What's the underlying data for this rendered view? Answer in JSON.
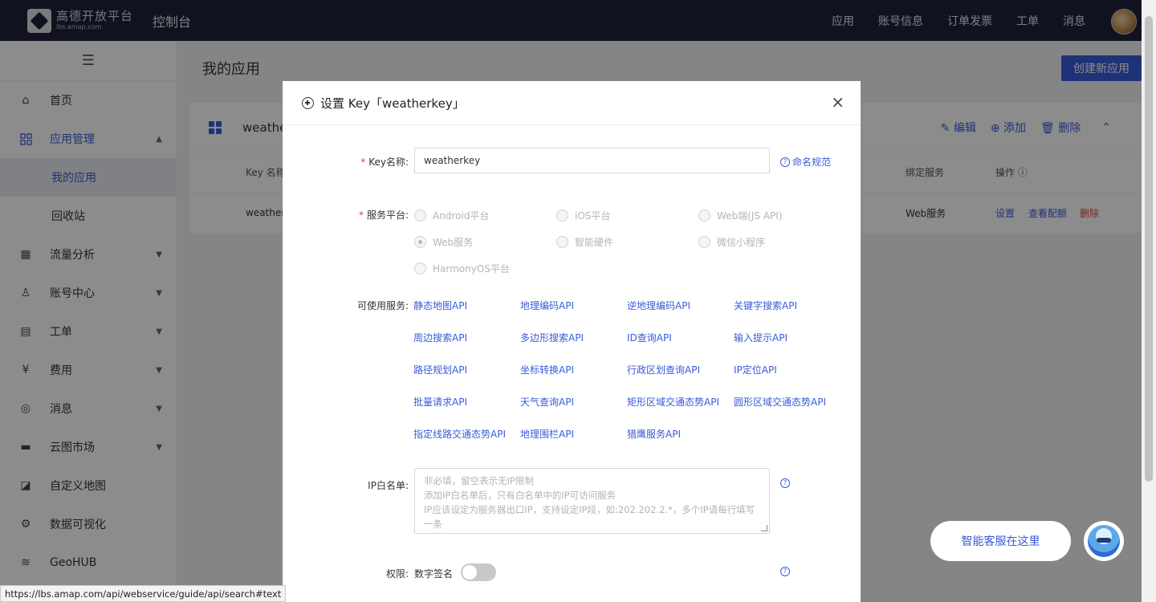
{
  "topbar": {
    "logo_line1": "高德开放平台",
    "logo_line2": "lbs.amap.com",
    "console": "控制台",
    "nav": [
      "应用",
      "账号信息",
      "订单发票",
      "工单",
      "消息"
    ]
  },
  "sidebar": {
    "toggle_icon": "☰",
    "items": [
      {
        "label": "首页",
        "icon": "home-icon"
      },
      {
        "label": "应用管理",
        "icon": "apps-icon"
      },
      {
        "label": "我的应用"
      },
      {
        "label": "回收站"
      },
      {
        "label": "流量分析",
        "icon": "chart-icon"
      },
      {
        "label": "账号中心",
        "icon": "user-icon"
      },
      {
        "label": "工单",
        "icon": "ticket-icon"
      },
      {
        "label": "费用",
        "icon": "yen-icon"
      },
      {
        "label": "消息",
        "icon": "message-icon"
      },
      {
        "label": "云图市场",
        "icon": "store-icon"
      },
      {
        "label": "自定义地图",
        "icon": "map-icon"
      },
      {
        "label": "数据可视化",
        "icon": "visual-icon"
      },
      {
        "label": "GeoHUB",
        "icon": "layers-icon"
      }
    ]
  },
  "main": {
    "title": "我的应用",
    "create_button": "创建新应用",
    "app_name": "weathe",
    "actions": {
      "edit": "编辑",
      "add": "添加",
      "delete": "删除"
    },
    "table": {
      "col_key_name": "Key 名称",
      "col_service": "绑定服务",
      "col_ops": "操作",
      "row_key": "weatherk",
      "row_service": "Web服务",
      "row_settings": "设置",
      "row_quota": "查看配额",
      "row_delete": "删除"
    }
  },
  "modal": {
    "title": "设置 Key「weatherkey」",
    "close": "×",
    "key_name_label": "Key名称:",
    "key_name_value": "weatherkey",
    "naming_rule": "命名规范",
    "platform_label": "服务平台:",
    "platforms": [
      "Android平台",
      "iOS平台",
      "Web端(JS API)",
      "Web服务",
      "智能硬件",
      "微信小程序",
      "HarmonyOS平台"
    ],
    "selected_platform": "Web服务",
    "services_label": "可使用服务:",
    "services": [
      "静态地图API",
      "地理编码API",
      "逆地理编码API",
      "关键字搜索API",
      "周边搜索API",
      "多边形搜索API",
      "ID查询API",
      "输入提示API",
      "路径规划API",
      "坐标转换API",
      "行政区划查询API",
      "IP定位API",
      "批量请求API",
      "天气查询API",
      "矩形区域交通态势API",
      "圆形区域交通态势API",
      "指定线路交通态势API",
      "地理围栏API",
      "猎鹰服务API"
    ],
    "ip_label": "IP白名单:",
    "ip_placeholder_lines": [
      "非必填，留空表示无IP限制",
      "添加IP白名单后，只有白名单中的IP可访问服务",
      "IP应该设定为服务器出口IP，支持设定IP段，如:202.202.2.*，多个IP请每行填写",
      "一条"
    ],
    "permission_label": "权限:",
    "permission_value": "数字签名",
    "permission_enabled": false
  },
  "status_url": "https://lbs.amap.com/api/webservice/guide/api/search#text",
  "customer_service": "智能客服在这里",
  "colors": {
    "accent": "#3a5bd9",
    "topbar": "#1f2239",
    "danger": "#e34040"
  }
}
